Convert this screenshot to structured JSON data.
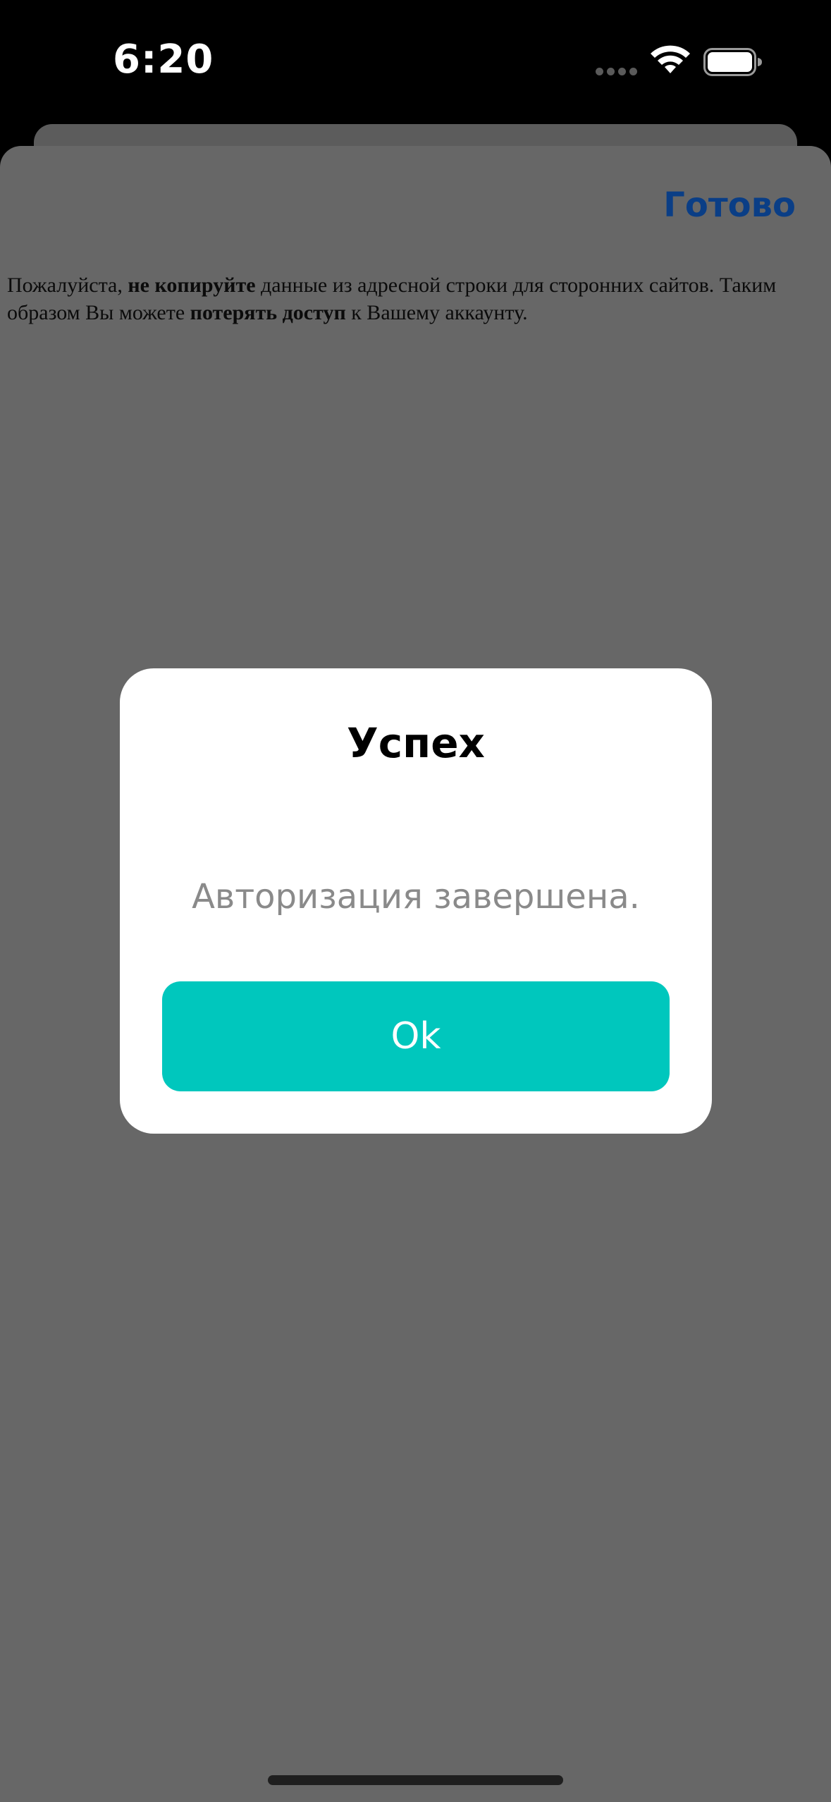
{
  "status_bar": {
    "time": "6:20",
    "icons": [
      "cellular-dots-icon",
      "wifi-icon",
      "battery-icon"
    ]
  },
  "sheet": {
    "done_label": "Готово",
    "notice": {
      "part1": "Пожалуйста, ",
      "bold1": "не копируйте",
      "part2": " данные из адресной строки для сторонних сайтов. Таким образом Вы можете ",
      "bold2": "потерять доступ",
      "part3": " к Вашему аккаунту."
    }
  },
  "dialog": {
    "title": "Успех",
    "message": "Авторизация завершена.",
    "ok_label": "Ok"
  },
  "colors": {
    "accent": "#00c7bd",
    "done_link": "#0a3e86",
    "overlay": "#676767",
    "status_bar_bg": "#000000"
  }
}
